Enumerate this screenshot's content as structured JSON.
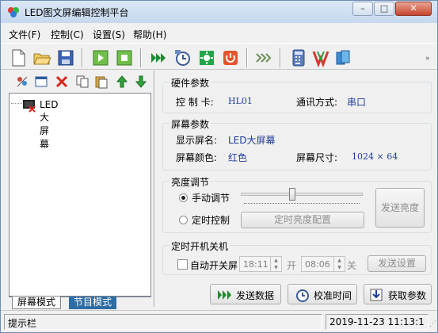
{
  "window": {
    "title": "LED图文屏编辑控制平台",
    "minimize": "–",
    "maximize": "□",
    "close": "✕"
  },
  "menu": [
    "文件(F)",
    "控制(C)",
    "设置(S)",
    "帮助(H)"
  ],
  "toolbar": {
    "icons": [
      "new-file-icon",
      "open-folder-icon",
      "save-icon",
      "play-preview-icon",
      "stop-preview-icon",
      "send-data-icon",
      "timer-sync-icon",
      "brightness-icon",
      "power-icon",
      "more-arrows-icon",
      "calculator-icon",
      "tools-icon",
      "help-book-icon"
    ]
  },
  "left_panel": {
    "tools": [
      "settings-icon",
      "window-icon",
      "delete-icon",
      "copy-icon",
      "paste-icon",
      "move-up-icon",
      "move-down-icon"
    ],
    "tree_item": "LED大屏幕",
    "tabs": [
      "屏幕模式",
      "节目模式"
    ]
  },
  "hardware": {
    "title": "硬件参数",
    "controller_label": "控 制 卡:",
    "controller_value": "HL01",
    "comm_label": "通讯方式:",
    "comm_value": "串口"
  },
  "screen": {
    "title": "屏幕参数",
    "name_label": "显示屏名:",
    "name_value": "LED大屏幕",
    "color_label": "屏幕颜色:",
    "color_value": "红色",
    "size_label": "屏幕尺寸:",
    "size_value": "1024 × 64"
  },
  "brightness": {
    "title": "亮度调节",
    "manual_label": "手动调节",
    "timed_label": "定时控制",
    "timed_config_button": "定时亮度配置",
    "send_button": "发送亮度",
    "mode": "manual",
    "slider_level_percent": 42
  },
  "schedule": {
    "title": "定时开机关机",
    "auto_label": "自动开关屏",
    "on_time": "18:11",
    "on_label": "开",
    "off_time": "08:06",
    "off_label": "关",
    "send_button": "发送设置"
  },
  "actions": {
    "send_data": "发送数据",
    "sync_time": "校准时间",
    "get_params": "获取参数"
  },
  "status": {
    "hint": "提示栏",
    "datetime": "2019-11-23 11:13:1"
  }
}
